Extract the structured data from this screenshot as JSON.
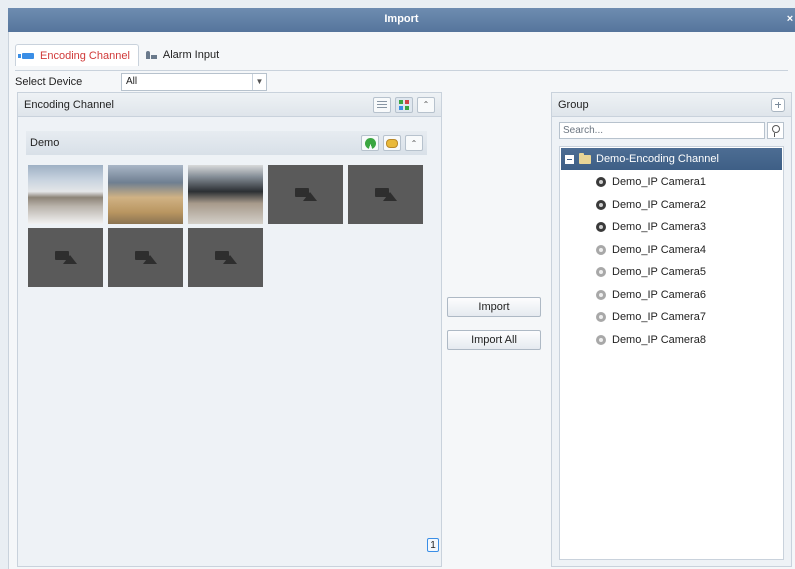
{
  "window": {
    "title": "Import",
    "close_glyph": "×"
  },
  "tabs": [
    {
      "label": "Encoding Channel",
      "icon": "camera-icon",
      "active": true
    },
    {
      "label": "Alarm Input",
      "icon": "alarm-icon",
      "active": false
    }
  ],
  "device": {
    "label": "Select Device",
    "selected": "All"
  },
  "left_panel": {
    "title": "Encoding Channel",
    "group_title": "Demo",
    "collapse_glyph": "⌃",
    "channels": [
      {
        "state": "live"
      },
      {
        "state": "live"
      },
      {
        "state": "live"
      },
      {
        "state": "no-signal"
      },
      {
        "state": "no-signal"
      },
      {
        "state": "no-signal"
      },
      {
        "state": "no-signal"
      },
      {
        "state": "no-signal"
      }
    ],
    "page": "1"
  },
  "actions": {
    "import_label": "Import",
    "import_all_label": "Import All"
  },
  "right_panel": {
    "title": "Group",
    "search_placeholder": "Search...",
    "root": "Demo-Encoding Channel",
    "cameras": [
      {
        "name": "Demo_IP Camera1",
        "online": true
      },
      {
        "name": "Demo_IP Camera2",
        "online": true
      },
      {
        "name": "Demo_IP Camera3",
        "online": true
      },
      {
        "name": "Demo_IP Camera4",
        "online": false
      },
      {
        "name": "Demo_IP Camera5",
        "online": false
      },
      {
        "name": "Demo_IP Camera6",
        "online": false
      },
      {
        "name": "Demo_IP Camera7",
        "online": false
      },
      {
        "name": "Demo_IP Camera8",
        "online": false
      }
    ]
  },
  "colors": {
    "titlebar": "#56759c",
    "tree_selected": "#3e5f86",
    "active_tab_text": "#d03a3a",
    "accent": "#3a8ee6"
  }
}
